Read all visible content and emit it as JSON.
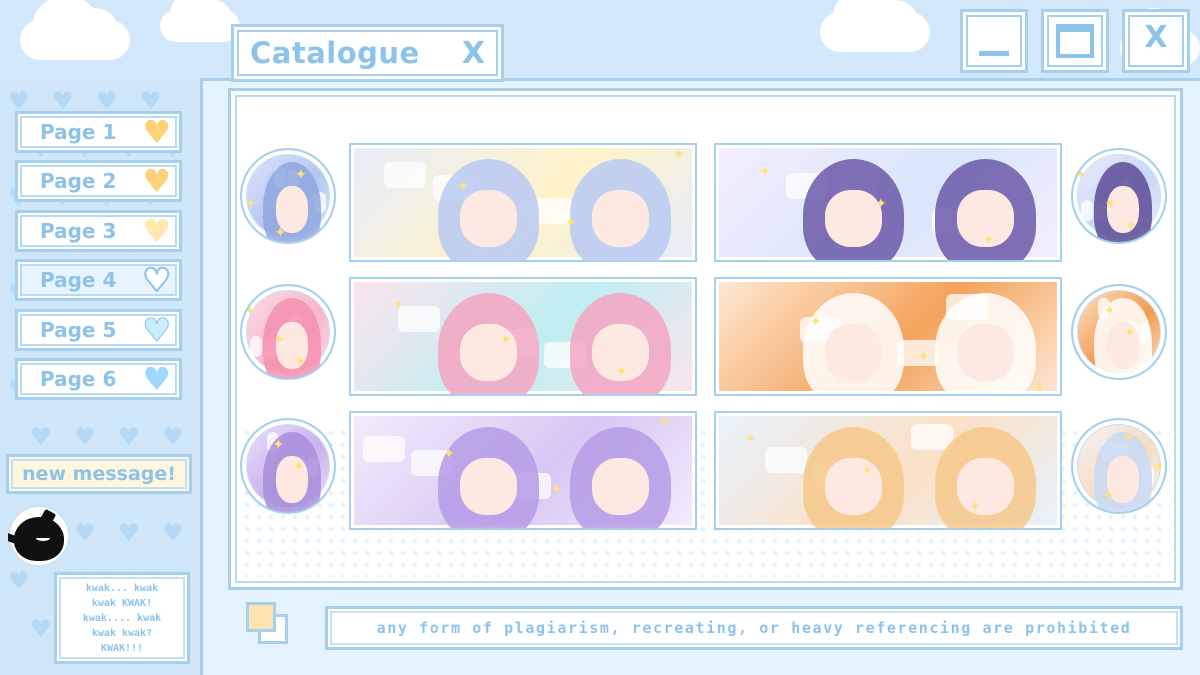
{
  "window": {
    "title": "Catalogue",
    "title_close": "X",
    "controls": {
      "minimize": "minimize-window",
      "maximize": "maximize-window",
      "close": "X"
    }
  },
  "sidebar": {
    "pages": [
      {
        "label": "Page 1",
        "heart_color": "#ffd27a",
        "heart_icon": "heart-icon"
      },
      {
        "label": "Page 2",
        "heart_color": "#ffd27a",
        "heart_icon": "heart-icon"
      },
      {
        "label": "Page 3",
        "heart_color": "#ffe7ad",
        "heart_icon": "heart-icon"
      },
      {
        "label": "Page 4",
        "heart_color": "#ffffff",
        "heart_icon": "heart-outline-icon"
      },
      {
        "label": "Page 5",
        "heart_color": "#c9ecff",
        "heart_icon": "heart-icon"
      },
      {
        "label": "Page 6",
        "heart_color": "#9fd8ff",
        "heart_icon": "heart-icon"
      }
    ],
    "new_message": "new message!",
    "speech": "kwak... kwak\nkwak KWAK!\nkwak.... kwak\nkwak kwak?\nKWAK!!!"
  },
  "footer": {
    "notice": "any form of plagiarism, recreating, or heavy referencing are prohibited"
  },
  "gallery": {
    "rows": [
      {
        "left_circle": {
          "palette": [
            "#dfe6fb",
            "#b4c7f2",
            "#8fa6de"
          ]
        },
        "left_banner": {
          "palette": [
            "#e6ecfc",
            "#fff3c9",
            "#b9c9f3"
          ]
        },
        "right_banner": {
          "palette": [
            "#f4eefc",
            "#d9e6fb",
            "#6b58a8"
          ]
        },
        "right_circle": {
          "palette": [
            "#f1ecfb",
            "#c8d8f6",
            "#5c4b96"
          ]
        }
      },
      {
        "left_circle": {
          "palette": [
            "#fde0ea",
            "#f7b6cb",
            "#f48fb0"
          ]
        },
        "left_banner": {
          "palette": [
            "#fde4ee",
            "#bfeef2",
            "#f5a4c2"
          ]
        },
        "right_banner": {
          "palette": [
            "#fde9d6",
            "#f3a35a",
            "#ffffff"
          ]
        },
        "right_circle": {
          "palette": [
            "#fde9d6",
            "#f39a4f",
            "#ffffff"
          ]
        }
      },
      {
        "left_circle": {
          "palette": [
            "#efe3fb",
            "#c9b2ee",
            "#a88ddc"
          ]
        },
        "left_banner": {
          "palette": [
            "#f3ecfb",
            "#d8c7f3",
            "#b59be6"
          ]
        },
        "right_banner": {
          "palette": [
            "#e6f2fd",
            "#fbe1c6",
            "#f6c88a"
          ]
        },
        "right_circle": {
          "palette": [
            "#f1f3fd",
            "#f7dcc3",
            "#c9d9f4"
          ]
        }
      }
    ]
  }
}
